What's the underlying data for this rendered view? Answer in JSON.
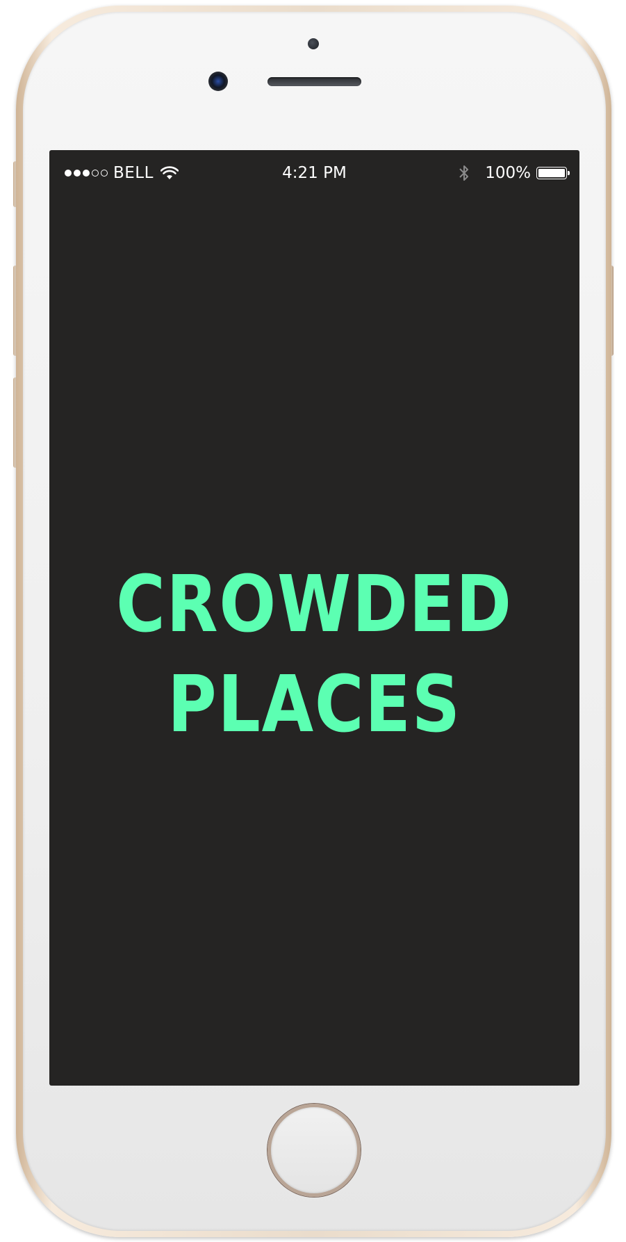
{
  "status_bar": {
    "signal_strength": 3,
    "signal_max": 5,
    "carrier": "BELL",
    "wifi_icon": "wifi-icon",
    "time": "4:21 PM",
    "bluetooth_icon": "bluetooth-icon",
    "battery_percent_label": "100%",
    "battery_level": 1.0
  },
  "splash": {
    "line1": "CROWDED",
    "line2": "PLACES",
    "title_color": "#5CFFB2",
    "background_color": "#252423"
  }
}
